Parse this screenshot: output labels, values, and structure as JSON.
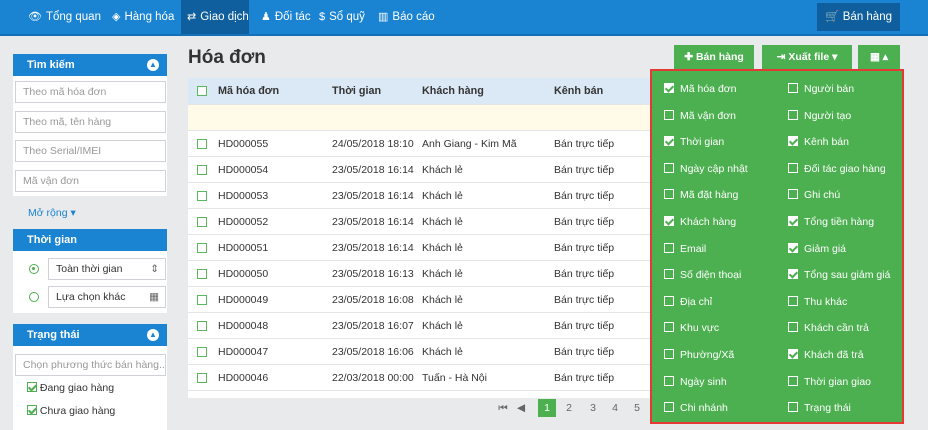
{
  "topnav": {
    "items": [
      {
        "icon": "eye-icon",
        "glyph": "👁",
        "label": "Tổng quan"
      },
      {
        "icon": "cube-icon",
        "glyph": "◈",
        "label": "Hàng hóa"
      },
      {
        "icon": "exchange-icon",
        "glyph": "⇄",
        "label": "Giao dịch"
      },
      {
        "icon": "person-icon",
        "glyph": "♟",
        "label": "Đối tác"
      },
      {
        "icon": "dollar-icon",
        "glyph": "$",
        "label": "Sổ quỹ"
      },
      {
        "icon": "chart-icon",
        "glyph": "▥",
        "label": "Báo cáo"
      }
    ],
    "sell_label": "Bán hàng"
  },
  "sidebar": {
    "search": {
      "title": "Tìm kiếm",
      "placeholders": [
        "Theo mã hóa đơn",
        "Theo mã, tên hàng",
        "Theo Serial/IMEI",
        "Mã vận đơn"
      ],
      "expand_label": "Mở rộng"
    },
    "time": {
      "title": "Thời gian",
      "options": [
        "Toàn thời gian",
        "Lựa chọn khác"
      ]
    },
    "status": {
      "title": "Trạng thái",
      "placeholder": "Chọn phương thức bán hàng...",
      "items": [
        "Đang giao hàng",
        "Chưa giao hàng"
      ]
    }
  },
  "main": {
    "title": "Hóa đơn",
    "buttons": {
      "sell": "Bán hàng",
      "export": "Xuất file"
    }
  },
  "table": {
    "headers": [
      "Mã hóa đơn",
      "Thời gian",
      "Khách hàng",
      "Kênh bán"
    ],
    "rows": [
      [
        "HD000055",
        "24/05/2018 18:10",
        "Anh Giang - Kim Mã",
        "Bán trực tiếp"
      ],
      [
        "HD000054",
        "23/05/2018 16:14",
        "Khách lẻ",
        "Bán trực tiếp"
      ],
      [
        "HD000053",
        "23/05/2018 16:14",
        "Khách lẻ",
        "Bán trực tiếp"
      ],
      [
        "HD000052",
        "23/05/2018 16:14",
        "Khách lẻ",
        "Bán trực tiếp"
      ],
      [
        "HD000051",
        "23/05/2018 16:14",
        "Khách lẻ",
        "Bán trực tiếp"
      ],
      [
        "HD000050",
        "23/05/2018 16:13",
        "Khách lẻ",
        "Bán trực tiếp"
      ],
      [
        "HD000049",
        "23/05/2018 16:08",
        "Khách lẻ",
        "Bán trực tiếp"
      ],
      [
        "HD000048",
        "23/05/2018 16:07",
        "Khách lẻ",
        "Bán trực tiếp"
      ],
      [
        "HD000047",
        "23/05/2018 16:06",
        "Khách lẻ",
        "Bán trực tiếp"
      ],
      [
        "HD000046",
        "22/03/2018 00:00",
        "Tuấn - Hà Nội",
        "Bán trực tiếp"
      ]
    ]
  },
  "pager": {
    "first": "⏮",
    "prev": "◀",
    "pages": [
      "1",
      "2",
      "3",
      "4",
      "5"
    ],
    "current": "1"
  },
  "columns": {
    "left": [
      {
        "label": "Mã hóa đơn",
        "checked": true
      },
      {
        "label": "Mã vận đơn",
        "checked": false
      },
      {
        "label": "Thời gian",
        "checked": true
      },
      {
        "label": "Ngày cập nhật",
        "checked": false
      },
      {
        "label": "Mã đặt hàng",
        "checked": false
      },
      {
        "label": "Khách hàng",
        "checked": true
      },
      {
        "label": "Email",
        "checked": false
      },
      {
        "label": "Số điện thoại",
        "checked": false
      },
      {
        "label": "Địa chỉ",
        "checked": false
      },
      {
        "label": "Khu vực",
        "checked": false
      },
      {
        "label": "Phường/Xã",
        "checked": false
      },
      {
        "label": "Ngày sinh",
        "checked": false
      },
      {
        "label": "Chi nhánh",
        "checked": false
      }
    ],
    "right": [
      {
        "label": "Người bán",
        "checked": false
      },
      {
        "label": "Người tạo",
        "checked": false
      },
      {
        "label": "Kênh bán",
        "checked": true
      },
      {
        "label": "Đối tác giao hàng",
        "checked": false
      },
      {
        "label": "Ghi chú",
        "checked": false
      },
      {
        "label": "Tổng tiền hàng",
        "checked": true
      },
      {
        "label": "Giảm giá",
        "checked": true
      },
      {
        "label": "Tổng sau giảm giá",
        "checked": true
      },
      {
        "label": "Thu khác",
        "checked": false
      },
      {
        "label": "Khách cần trả",
        "checked": false
      },
      {
        "label": "Khách đã trả",
        "checked": true
      },
      {
        "label": "Thời gian giao",
        "checked": false
      },
      {
        "label": "Trạng thái",
        "checked": false
      }
    ]
  },
  "colors": {
    "nav": "#1a84d2",
    "green": "#4caf50",
    "highlight": "#e53935"
  }
}
